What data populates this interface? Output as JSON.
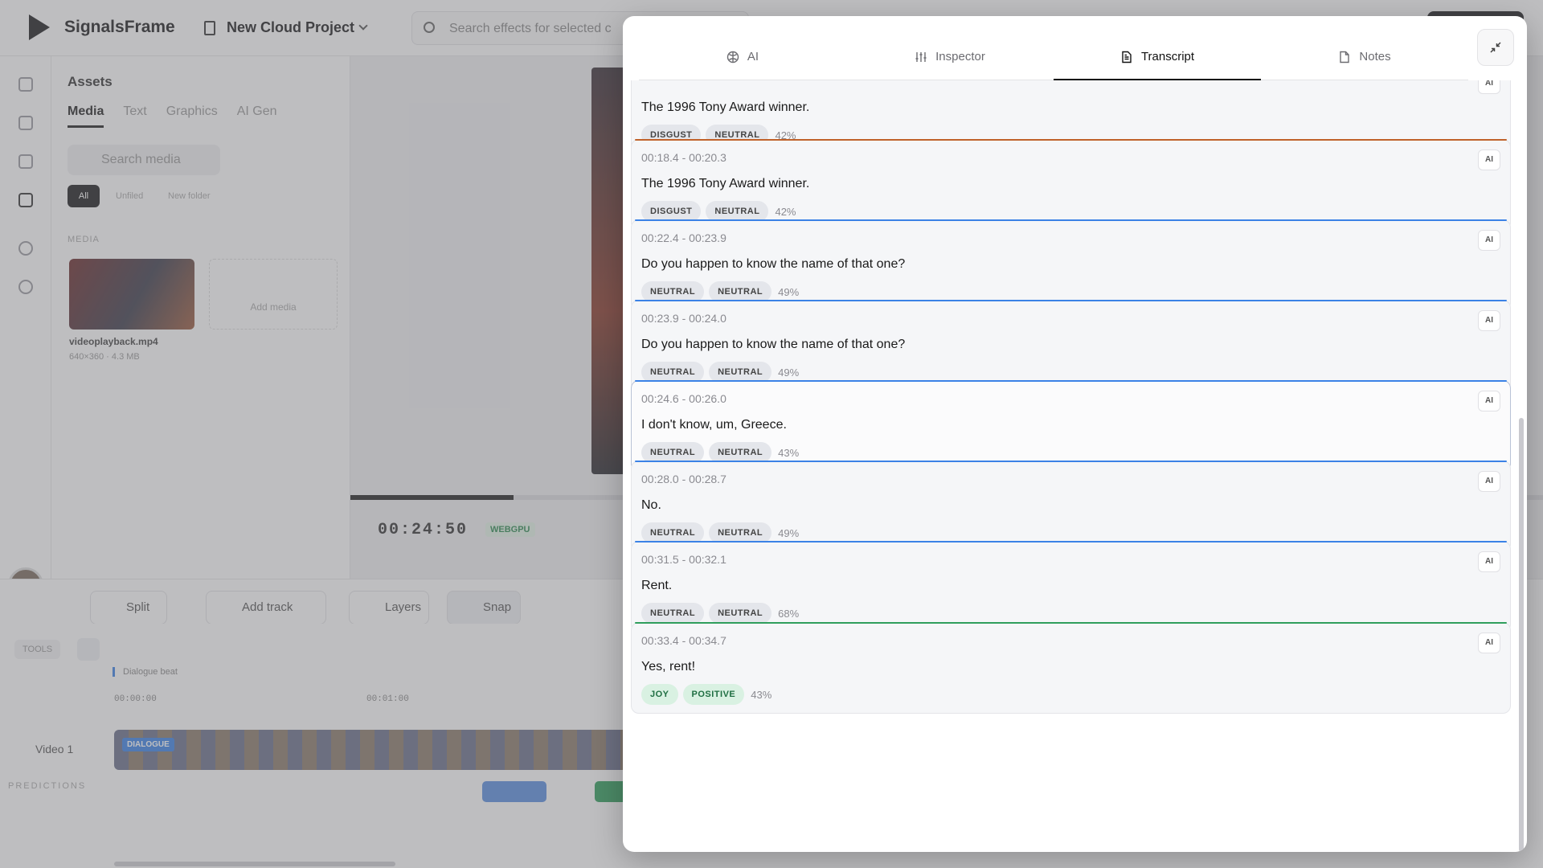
{
  "app": {
    "name": "SignalsFrame",
    "project": "New Cloud Project",
    "search_placeholder": "Search effects for selected c"
  },
  "assets": {
    "title": "Assets",
    "tabs": [
      "Media",
      "Text",
      "Graphics",
      "AI Gen"
    ],
    "search_placeholder": "Search media",
    "filters": [
      "All",
      "Unfiled",
      "New folder"
    ],
    "section_label": "MEDIA",
    "file_name": "videoplayback.mp4",
    "file_meta": "640×360 · 4.3 MB",
    "add_media": "Add media"
  },
  "player": {
    "timecode": "00:24:50",
    "renderer": "WEBGPU",
    "progress": 0.137
  },
  "toolbar": {
    "split": "Split",
    "add_track": "Add track",
    "layers": "Layers",
    "snap": "Snap"
  },
  "timeline": {
    "tools_label": "TOOLS",
    "marker_label": "Dialogue beat",
    "ruler": [
      "00:00:00",
      "00:01:00"
    ],
    "track_name": "Video 1",
    "clip_tag": "DIALOGUE",
    "predictions_label": "PREDICTIONS"
  },
  "panel": {
    "tabs": [
      {
        "label": "AI",
        "icon": "ai-icon"
      },
      {
        "label": "Inspector",
        "icon": "sliders-icon"
      },
      {
        "label": "Transcript",
        "icon": "document-icon"
      },
      {
        "label": "Notes",
        "icon": "note-icon"
      }
    ],
    "active_tab": "Transcript",
    "ai_tag": "AI",
    "segments": [
      {
        "time": "",
        "text": "The 1996 Tony Award winner.",
        "emotion": "DISGUST",
        "sentiment": "NEUTRAL",
        "confidence": "42%",
        "accent": "#e4e5e9",
        "positive": false,
        "highlight": false
      },
      {
        "time": "00:18.4 - 00:20.3",
        "text": "The 1996 Tony Award winner.",
        "emotion": "DISGUST",
        "sentiment": "NEUTRAL",
        "confidence": "42%",
        "accent": "#c0622a",
        "positive": false,
        "highlight": false
      },
      {
        "time": "00:22.4 - 00:23.9",
        "text": "Do you happen to know the name of that one?",
        "emotion": "NEUTRAL",
        "sentiment": "NEUTRAL",
        "confidence": "49%",
        "accent": "#3b82e6",
        "positive": false,
        "highlight": false
      },
      {
        "time": "00:23.9 - 00:24.0",
        "text": "Do you happen to know the name of that one?",
        "emotion": "NEUTRAL",
        "sentiment": "NEUTRAL",
        "confidence": "49%",
        "accent": "#3b82e6",
        "positive": false,
        "highlight": false
      },
      {
        "time": "00:24.6 - 00:26.0",
        "text": "I don't know, um, Greece.",
        "emotion": "NEUTRAL",
        "sentiment": "NEUTRAL",
        "confidence": "43%",
        "accent": "#3b82e6",
        "positive": false,
        "highlight": true
      },
      {
        "time": "00:28.0 - 00:28.7",
        "text": "No.",
        "emotion": "NEUTRAL",
        "sentiment": "NEUTRAL",
        "confidence": "49%",
        "accent": "#3b82e6",
        "positive": false,
        "highlight": false
      },
      {
        "time": "00:31.5 - 00:32.1",
        "text": "Rent.",
        "emotion": "NEUTRAL",
        "sentiment": "NEUTRAL",
        "confidence": "68%",
        "accent": "#3b82e6",
        "positive": false,
        "highlight": false
      },
      {
        "time": "00:33.4 - 00:34.7",
        "text": "Yes, rent!",
        "emotion": "JOY",
        "sentiment": "POSITIVE",
        "confidence": "43%",
        "accent": "#2f9e5c",
        "positive": true,
        "highlight": false
      }
    ]
  }
}
